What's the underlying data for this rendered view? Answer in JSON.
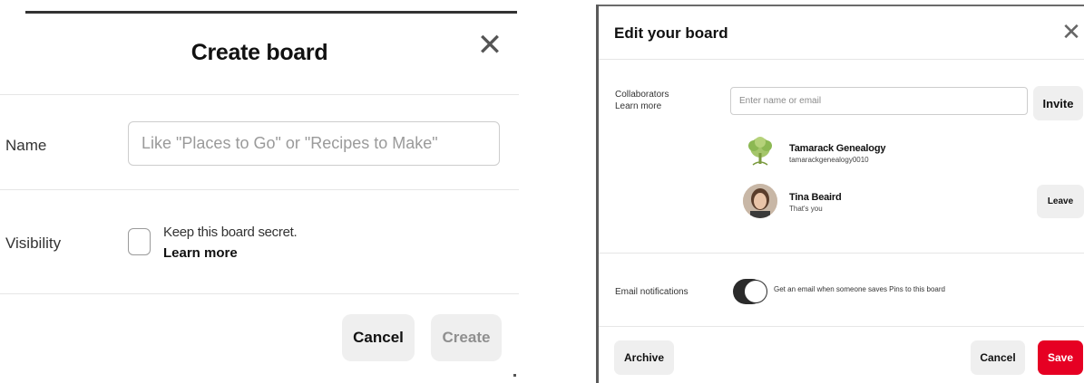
{
  "create_board": {
    "title": "Create board",
    "close_icon": "close-icon",
    "name_label": "Name",
    "name_placeholder": "Like \"Places to Go\" or \"Recipes to Make\"",
    "visibility_label": "Visibility",
    "secret_text": "Keep this board secret.",
    "learn_more": "Learn more",
    "cancel_label": "Cancel",
    "create_label": "Create",
    "create_enabled": false
  },
  "edit_board": {
    "title": "Edit your board",
    "close_icon": "close-icon",
    "collaborators_label": "Collaborators",
    "learn_more": "Learn more",
    "collab_placeholder": "Enter name or email",
    "invite_label": "Invite",
    "collaborators": [
      {
        "name": "Tamarack Genealogy",
        "sub": "tamarackgenealogy0010",
        "avatar": "tree-avatar"
      },
      {
        "name": "Tina Beaird",
        "sub": "That's you",
        "avatar": "photo-avatar"
      }
    ],
    "leave_label": "Leave",
    "email_label": "Email notifications",
    "email_desc": "Get an email when someone saves Pins to this board",
    "email_enabled": true,
    "archive_label": "Archive",
    "cancel_label": "Cancel",
    "save_label": "Save"
  },
  "colors": {
    "primary_save": "#e60023",
    "button_grey": "#efefef",
    "toggle_on": "#2b2b2b"
  }
}
